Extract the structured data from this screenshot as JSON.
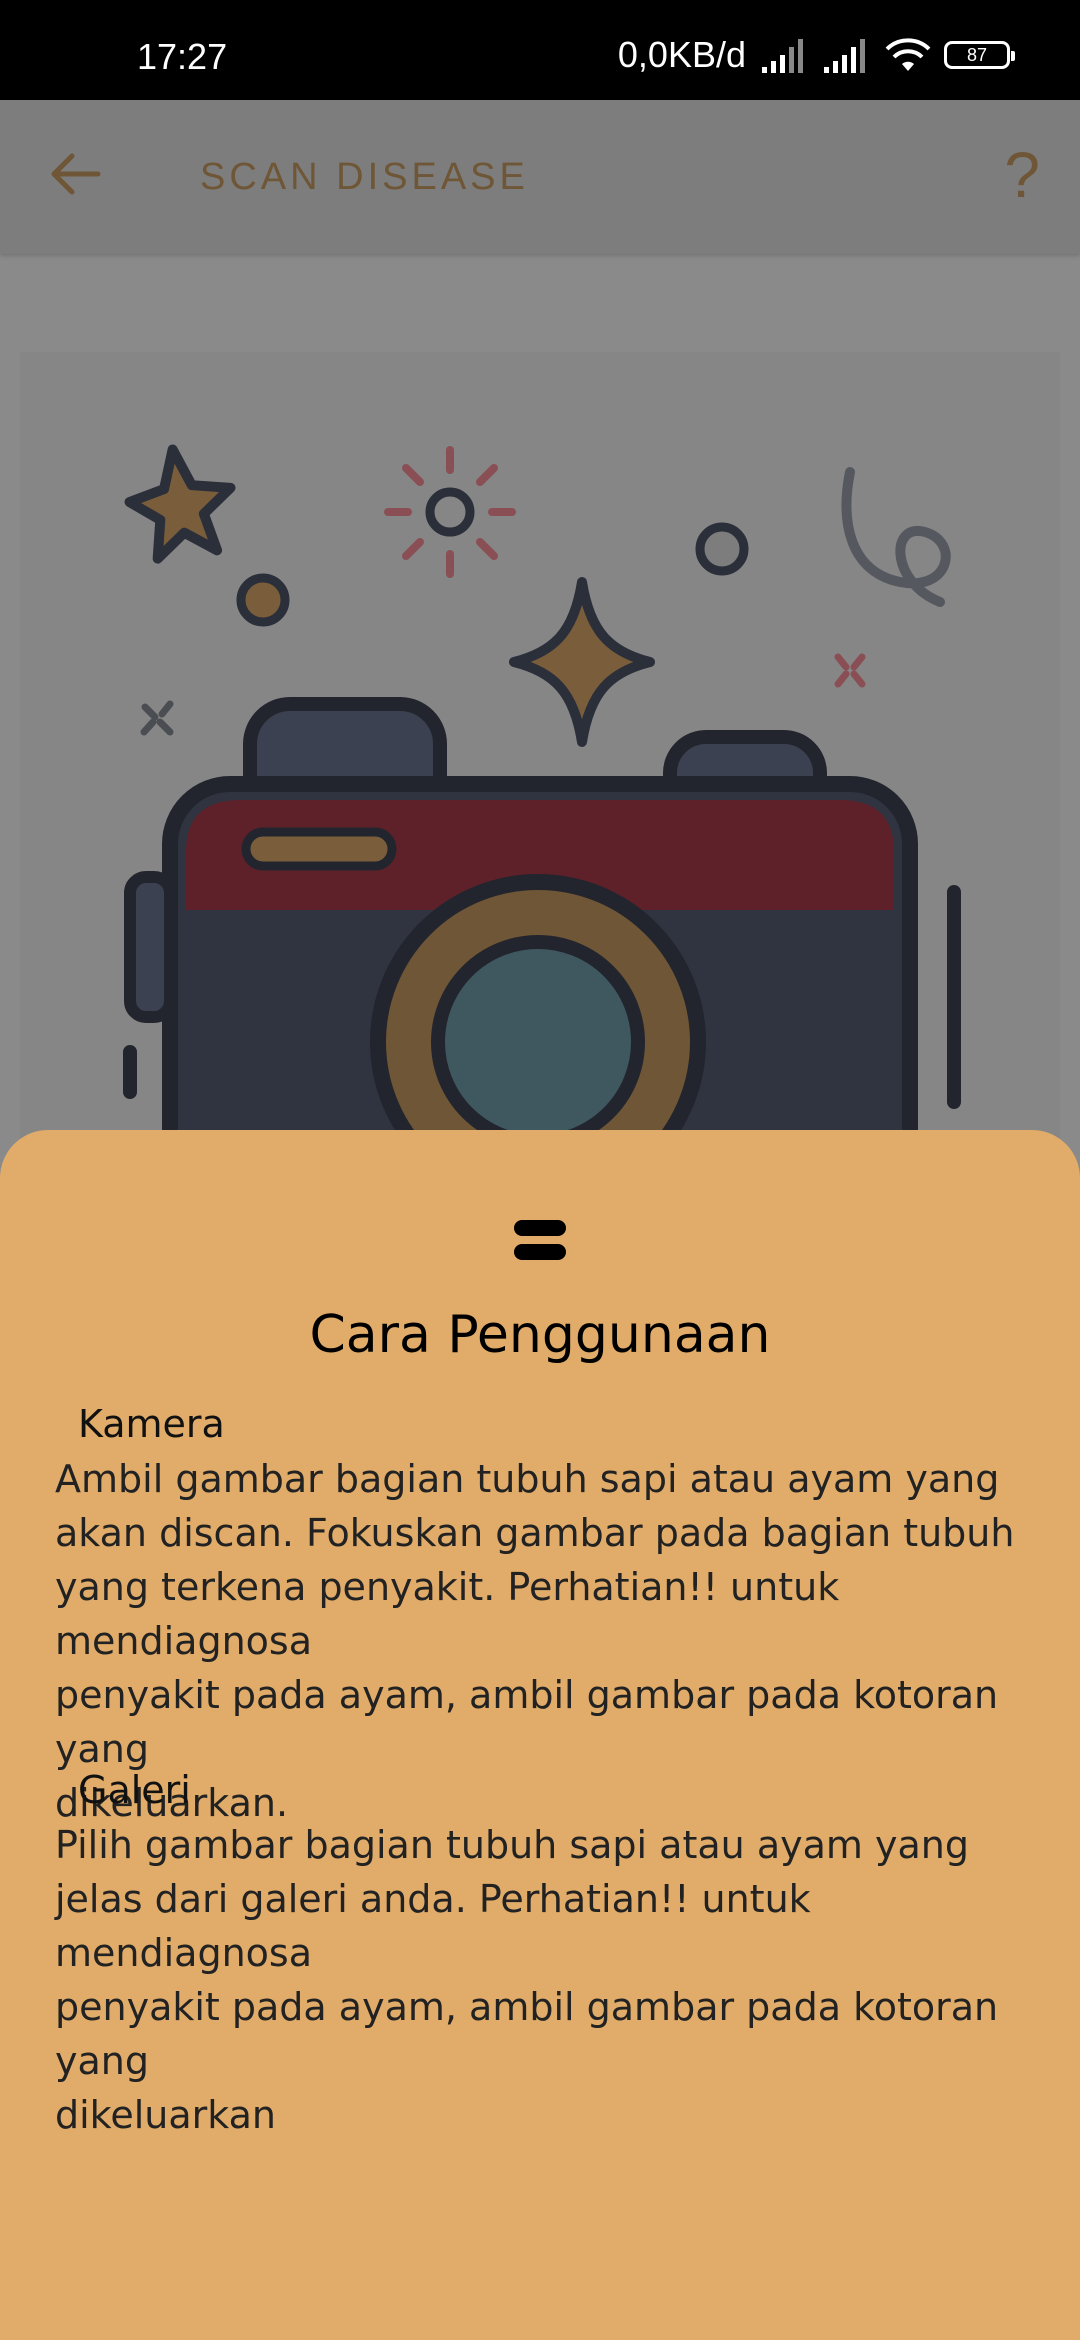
{
  "status_bar": {
    "time": "17:27",
    "network_speed": "0,0KB/d",
    "battery": "87"
  },
  "app_bar": {
    "title": "SCAN DISEASE",
    "help": "?"
  },
  "bottom_sheet": {
    "title": "Cara Penggunaan",
    "sections": [
      {
        "heading": "Kamera",
        "text": "Ambil gambar bagian tubuh sapi atau ayam yang\nakan discan. Fokuskan gambar pada bagian tubuh\nyang terkena penyakit. Perhatian!! untuk mendiagnosa\npenyakit pada ayam, ambil gambar pada kotoran yang\ndikeluarkan."
      },
      {
        "heading": "Galeri",
        "text": "Pilih gambar bagian tubuh sapi atau ayam yang\njelas dari galeri anda. Perhatian!! untuk mendiagnosa\npenyakit pada ayam, ambil gambar pada kotoran yang\ndikeluarkan"
      }
    ]
  },
  "colors": {
    "sheet_background": "#e1ac69",
    "scrim": "#8a8a8a",
    "app_bar_accent": "#6e5636"
  }
}
